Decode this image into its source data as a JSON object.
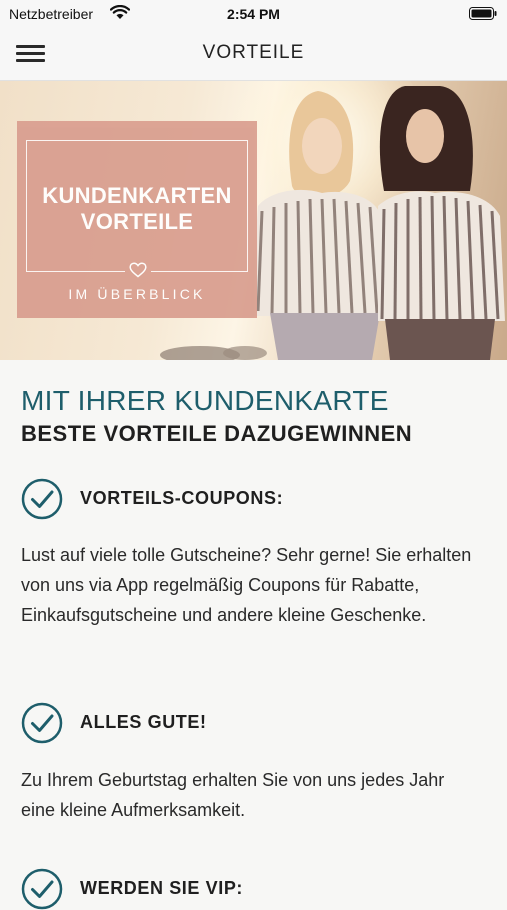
{
  "status_bar": {
    "carrier": "Netzbetreiber",
    "time": "2:54 PM"
  },
  "nav": {
    "title": "VORTEILE"
  },
  "hero": {
    "promo_line1": "KUNDENKARTEN",
    "promo_line2": "VORTEILE",
    "promo_sub": "IM ÜBERBLICK"
  },
  "content": {
    "headline": "MIT IHRER KUNDENKARTE",
    "subheadline": "BESTE VORTEILE DAZUGEWINNEN",
    "benefits": [
      {
        "title": "VORTEILS-COUPONS:",
        "text": "Lust auf viele tolle Gutscheine? Sehr gerne! Sie erhalten von uns via App regelmäßig Coupons für Rabatte, Einkaufsgutscheine und andere kleine Geschenke."
      },
      {
        "title": "ALLES GUTE!",
        "text": "Zu Ihrem Geburtstag erhalten Sie von uns jedes Jahr eine kleine Aufmerksamkeit."
      },
      {
        "title": "WERDEN SIE VIP:",
        "text": ""
      }
    ]
  },
  "colors": {
    "accent": "#1e5e6b",
    "promo": "#d99e8f"
  }
}
